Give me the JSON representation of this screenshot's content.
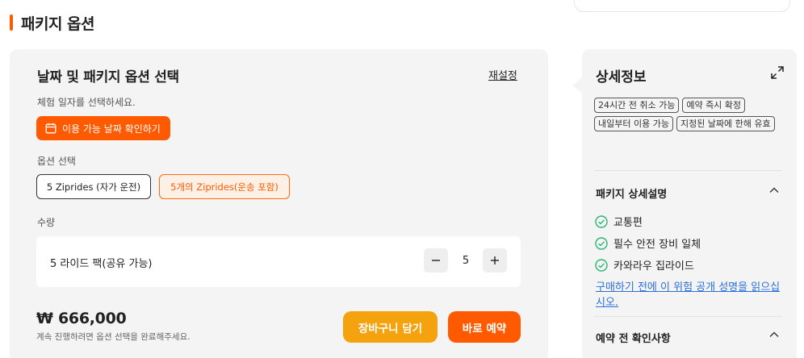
{
  "section": {
    "title": "패키지 옵션"
  },
  "panel": {
    "title": "날짜 및 패키지 옵션 선택",
    "reset_label": "재설정",
    "date_hint": "체험 일자를 선택하세요.",
    "date_button_label": "이용 가능 날짜 확인하기",
    "options_label": "옵션 선택",
    "options": [
      {
        "label": "5 Ziprides (자가 운전)",
        "selected": false
      },
      {
        "label": "5개의 Ziprides(운송 포함)",
        "selected": true
      }
    ],
    "quantity_label": "수량",
    "quantity_item": "5 라이드 팩(공유 가능)",
    "quantity_value": "5",
    "price": "₩ 666,000",
    "price_note": "계속 진행하려면 옵션 선택을 완료해주세요.",
    "cart_button": "장바구니 담기",
    "book_button": "바로 예약"
  },
  "details": {
    "title": "상세정보",
    "tags": [
      "24시간 전 취소 가능",
      "예약 즉시 확정",
      "내일부터 이용 가능",
      "지정된 날짜에 한해 유효"
    ],
    "package_heading": "패키지 상세설명",
    "includes": [
      "교통편",
      "필수 안전 장비 일체",
      "카와라우 집라이드"
    ],
    "waiver_link": "구매하기 전에 이 위험 공개 성명을 읽으십시오.",
    "confirm_heading": "예약 전 확인사항"
  },
  "colors": {
    "accent": "#ff5a00",
    "cart": "#f5a20f",
    "check": "#2bb673",
    "link": "#2a6fdb"
  }
}
